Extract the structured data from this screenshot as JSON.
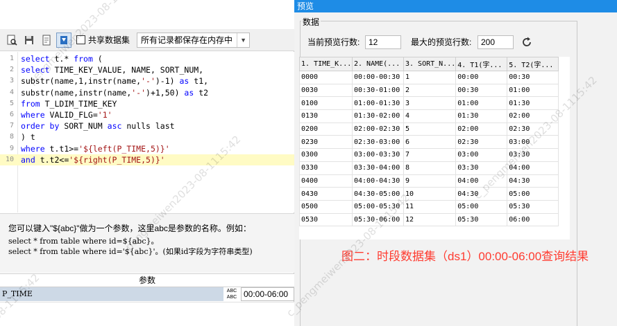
{
  "toolbar": {
    "share_dataset_label": "共享数据集",
    "cache_mode_value": "所有记录都保存在内存中"
  },
  "editor": {
    "lines": [
      {
        "no": "1"
      },
      {
        "no": "2"
      },
      {
        "no": "3"
      },
      {
        "no": "4"
      },
      {
        "no": "5"
      },
      {
        "no": "6"
      },
      {
        "no": "7"
      },
      {
        "no": "8"
      },
      {
        "no": "9"
      },
      {
        "no": "10"
      }
    ]
  },
  "hint": {
    "line1": "您可以键入\"${abc}\"做为一个参数，这里abc是参数的名称。例如：",
    "line2": "select * from table where id=${abc}。",
    "line3": "select * from table where id='${abc}'。(如果id字段为字符串类型)"
  },
  "params": {
    "header": "参数",
    "rows": [
      {
        "name": "P_TIME",
        "type_top": "ABC",
        "type_bottom": "ABC",
        "value": "00:00-06:00"
      }
    ]
  },
  "preview": {
    "title": "预览",
    "group_label": "数据",
    "current_rows_label": "当前预览行数:",
    "current_rows_value": "12",
    "max_rows_label": "最大的预览行数:",
    "max_rows_value": "200",
    "columns": [
      "1. TIME_K...",
      "2. NAME(...",
      "3. SORT_N...",
      "4. T1(字...",
      "5. T2(字..."
    ],
    "rows": [
      [
        "0000",
        "00:00-00:30",
        "1",
        "00:00",
        "00:30"
      ],
      [
        "0030",
        "00:30-01:00",
        "2",
        "00:30",
        "01:00"
      ],
      [
        "0100",
        "01:00-01:30",
        "3",
        "01:00",
        "01:30"
      ],
      [
        "0130",
        "01:30-02:00",
        "4",
        "01:30",
        "02:00"
      ],
      [
        "0200",
        "02:00-02:30",
        "5",
        "02:00",
        "02:30"
      ],
      [
        "0230",
        "02:30-03:00",
        "6",
        "02:30",
        "03:00"
      ],
      [
        "0300",
        "03:00-03:30",
        "7",
        "03:00",
        "03:30"
      ],
      [
        "0330",
        "03:30-04:00",
        "8",
        "03:30",
        "04:00"
      ],
      [
        "0400",
        "04:00-04:30",
        "9",
        "04:00",
        "04:30"
      ],
      [
        "0430",
        "04:30-05:00",
        "10",
        "04:30",
        "05:00"
      ],
      [
        "0500",
        "05:00-05:30",
        "11",
        "05:00",
        "05:30"
      ],
      [
        "0530",
        "05:30-06:00",
        "12",
        "05:30",
        "06:00"
      ]
    ],
    "caption": "图二：时段数据集（ds1）00:00-06:00查询结果"
  },
  "watermark": {
    "text1": "pengmeiwen2023-08-1115:42",
    "text2": "c_pengmeiwen2023-08-1115:42",
    "text3": "08-1115:42"
  },
  "colors": {
    "title_bar": "#1e8ce6",
    "keyword": "#0000ff",
    "string": "#a31515",
    "highlight_line": "#fffbc4",
    "caption": "#ff3b30"
  }
}
